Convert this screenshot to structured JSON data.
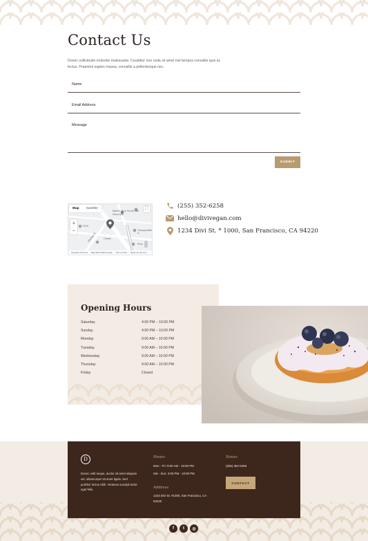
{
  "contact": {
    "title": "Contact Us",
    "intro": "Donec sollicitudin molestie malesuada. Curabitur non nulla sit amet nisl tempus convallis quis ac lectus. Praesent sapien massa, convallis a pellentesque nec.",
    "fields": {
      "name": "Name",
      "email": "Email Address",
      "message": "Message"
    },
    "submit_label": "SUBMIT"
  },
  "map": {
    "tab_map": "Map",
    "tab_satellite": "Satellite",
    "zoom_in": "+",
    "zoom_out": "−",
    "labels": {
      "place": "Market St & South Van Ness Ave",
      "transport": "Transportation A",
      "street": "Market St",
      "pos": "POS",
      "bank": "Chase",
      "pets": "Pets"
    },
    "footer": {
      "keyboard": "Keyboard shortcuts",
      "data": "Map data ©2023 Google",
      "terms": "Terms of Use",
      "report": "Report a map error"
    }
  },
  "info": {
    "phone": "(255) 352-6258",
    "email": "hello@divivegan.com",
    "address": "1234 Divi St. * 1000, San Francisco, CA 94220"
  },
  "hours": {
    "title": "Opening Hours",
    "rows": [
      {
        "day": "Saturday",
        "time": "4:00 PM – 10:00 PM"
      },
      {
        "day": "Sunday",
        "time": "4:00 PM – 10:00 PM"
      },
      {
        "day": "Monday",
        "time": "9:00 AM – 10:00 PM"
      },
      {
        "day": "Tuesday",
        "time": "9:00 AM – 10:00 PM"
      },
      {
        "day": "Wednesday",
        "time": "9:00 AM – 10:00 PM"
      },
      {
        "day": "Thursday",
        "time": "9:00 AM – 10:00 PM"
      },
      {
        "day": "Friday",
        "time": "Closed"
      }
    ]
  },
  "footer": {
    "logo_letter": "D",
    "about": "Donec velit neque, auctor sit amet aliquam vel, ullamcorper sit amet ligula. Sed porttitor lectus nibh. Vivamus suscipit tortor eget felis.",
    "hours_heading": "Hours",
    "hours_line1": "Mon - Fri: 9:00 AM - 10:00 PM",
    "hours_line2": "Sat - Sun: 4:00 PM - 10:00 PM",
    "address_heading": "Address",
    "address_text": "1234 Divi St. #1000, San Francisco, CA 94220",
    "contact_heading": "Hours",
    "phone": "(255) 352-6258",
    "contact_button": "CONTACT"
  },
  "social": [
    "f",
    "t",
    "◎"
  ],
  "colors": {
    "accent": "#b89b70",
    "dark_brown": "#3d271d",
    "cream": "#f3ece5"
  }
}
